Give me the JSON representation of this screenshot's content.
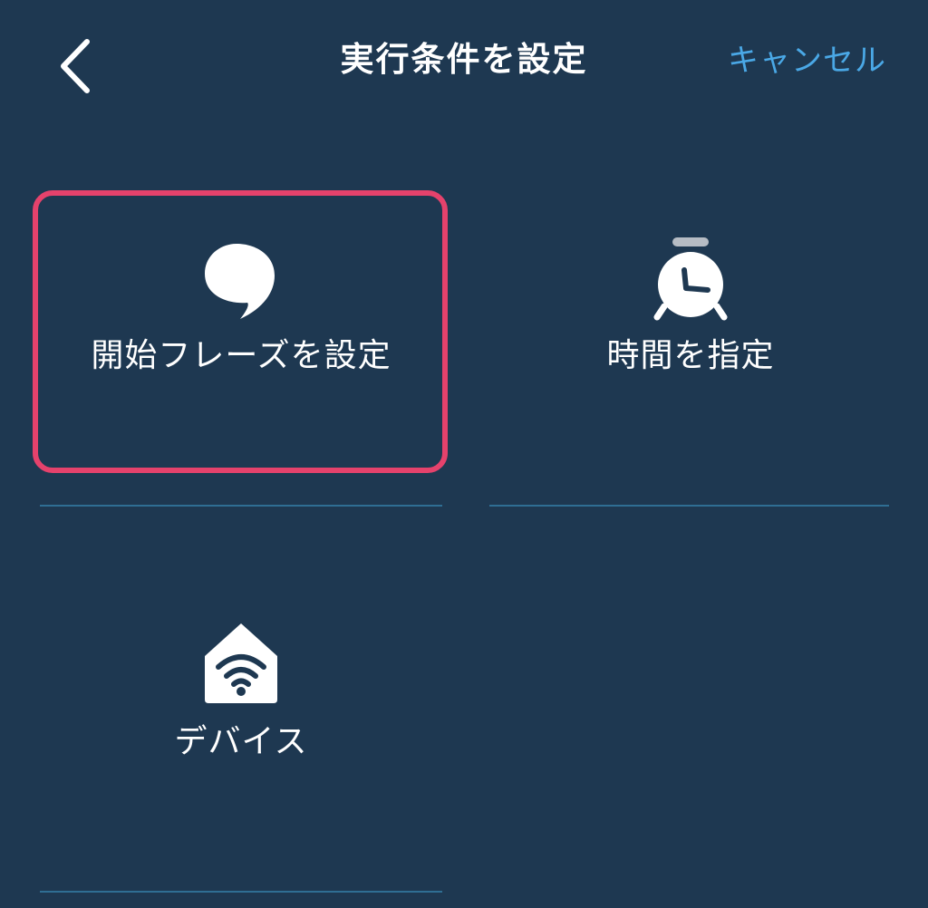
{
  "header": {
    "back_icon": "chevron-left-icon",
    "title": "実行条件を設定",
    "cancel_label": "キャンセル"
  },
  "options": [
    {
      "label": "開始フレーズを設定",
      "icon": "speech-bubble-icon",
      "selected": true
    },
    {
      "label": "時間を指定",
      "icon": "alarm-clock-icon",
      "selected": false
    },
    {
      "label": "デバイス",
      "icon": "home-wifi-icon",
      "selected": false
    }
  ],
  "colors": {
    "background": "#1e3851",
    "accent": "#4aa8e6",
    "highlight": "#e5426c",
    "divider": "#2f6e93",
    "text": "#ffffff"
  }
}
